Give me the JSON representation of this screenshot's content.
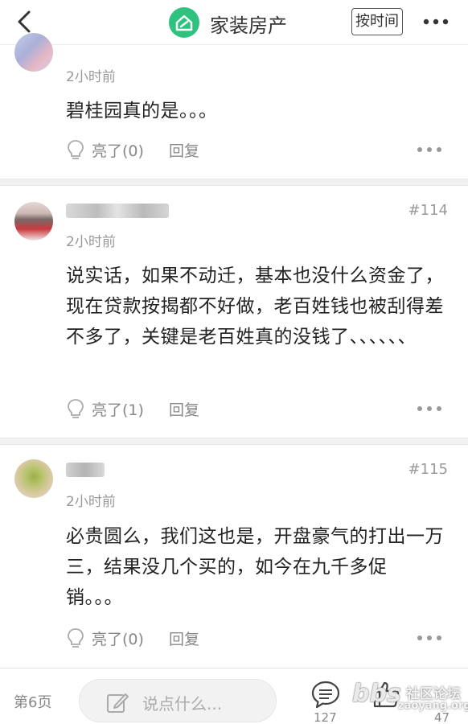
{
  "header": {
    "title": "家装房产",
    "sort_label": "按时间",
    "brand_color": "#2ec27e"
  },
  "posts": [
    {
      "floor": "",
      "time": "2小时前",
      "content": "碧桂园真的是。。。",
      "like_label": "亮了(0)",
      "reply_label": "回复"
    },
    {
      "floor": "#114",
      "time": "2小时前",
      "content": "说实话，如果不动迁，基本也没什么资金了，现在贷款按揭都不好做，老百姓钱也被刮得差不多了，关键是老百姓真的没钱了、、、、、、",
      "like_label": "亮了(1)",
      "reply_label": "回复"
    },
    {
      "floor": "#115",
      "time": "2小时前",
      "content": "必贵圆么，我们这也是，开盘豪气的打出一万三，结果没几个买的，如今在九千多促销。。。",
      "like_label": "亮了(0)",
      "reply_label": "回复"
    }
  ],
  "bottom": {
    "page_label": "第6页",
    "input_placeholder": "说点什么...",
    "comment_count": "127",
    "like_count": "47"
  },
  "watermark": {
    "text": "bbs",
    "cn": "社区论坛",
    "domain": "zaoyang.org"
  },
  "icons": [
    "back-icon",
    "app-logo-icon",
    "more-icon",
    "bulb-icon",
    "pencil-icon",
    "comment-icon",
    "thumb-up-icon"
  ]
}
